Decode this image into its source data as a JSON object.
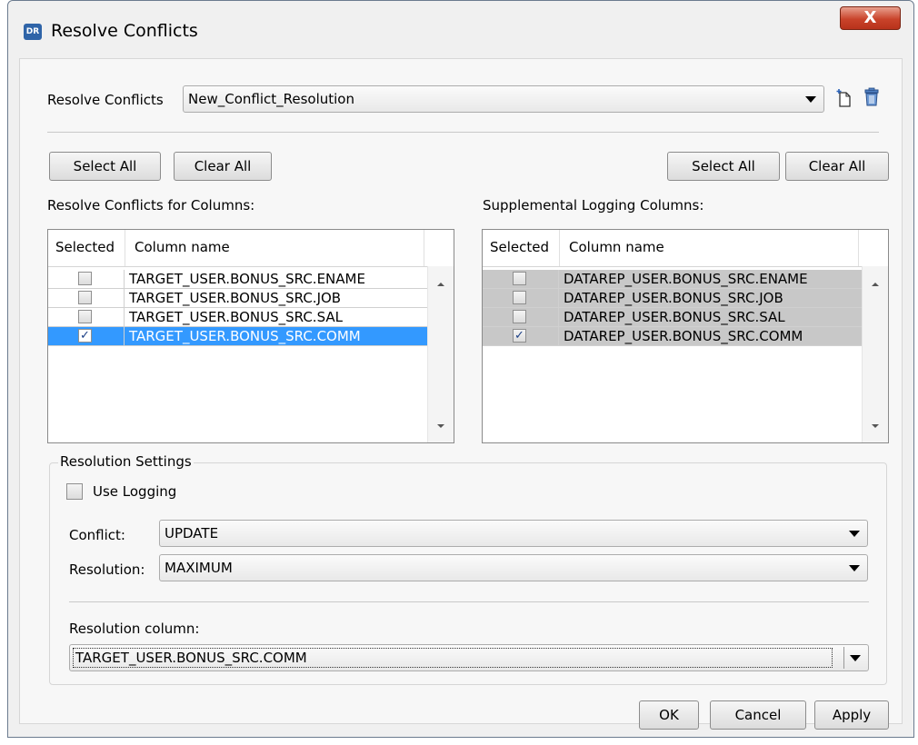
{
  "window": {
    "app_icon_text": "DR",
    "title": "Resolve Conflicts",
    "close_label": "X"
  },
  "top": {
    "label": "Resolve Conflicts",
    "selected": "New_Conflict_Resolution",
    "icons": [
      "new-document-icon",
      "trash-icon"
    ]
  },
  "left": {
    "select_all": "Select All",
    "clear_all": "Clear All",
    "heading": "Resolve Conflicts for Columns:",
    "columns": [
      "Selected",
      "Column name"
    ],
    "rows": [
      {
        "checked": "",
        "name": "TARGET_USER.BONUS_SRC.ENAME"
      },
      {
        "checked": "",
        "name": "TARGET_USER.BONUS_SRC.JOB"
      },
      {
        "checked": "",
        "name": "TARGET_USER.BONUS_SRC.SAL"
      },
      {
        "checked": "✓",
        "name": "TARGET_USER.BONUS_SRC.COMM"
      }
    ]
  },
  "right": {
    "select_all": "Select All",
    "clear_all": "Clear All",
    "heading": "Supplemental Logging Columns:",
    "columns": [
      "Selected",
      "Column name"
    ],
    "rows": [
      {
        "checked": "",
        "name": "DATAREP_USER.BONUS_SRC.ENAME"
      },
      {
        "checked": "",
        "name": "DATAREP_USER.BONUS_SRC.JOB"
      },
      {
        "checked": "",
        "name": "DATAREP_USER.BONUS_SRC.SAL"
      },
      {
        "checked": "✓",
        "name": "DATAREP_USER.BONUS_SRC.COMM"
      }
    ]
  },
  "settings": {
    "title": "Resolution Settings",
    "use_logging": "Use Logging",
    "conflict_label": "Conflict:",
    "conflict_value": "UPDATE",
    "resolution_label": "Resolution:",
    "resolution_value": "MAXIMUM",
    "resolution_column_label": "Resolution column:",
    "resolution_column_value": "TARGET_USER.BONUS_SRC.COMM"
  },
  "footer": {
    "ok": "OK",
    "cancel": "Cancel",
    "apply": "Apply"
  },
  "colors": {
    "selection": "#3399ff",
    "disabled_row": "#c8c8c8",
    "close_button": "#c9432a"
  }
}
